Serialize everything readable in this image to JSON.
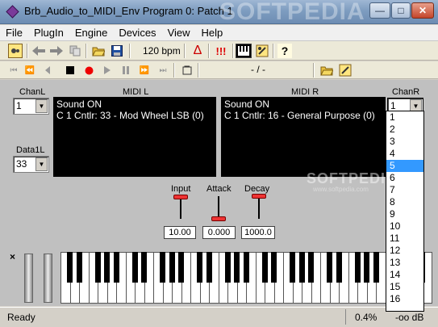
{
  "window": {
    "title": "Brb_Audio_to_MIDI_Env Program 0: Patch   1",
    "watermark": "SOFTPEDIA",
    "minimize": "—",
    "maximize": "□",
    "close": "✕"
  },
  "menu": [
    "File",
    "PlugIn",
    "Engine",
    "Devices",
    "View",
    "Help"
  ],
  "toolbar": {
    "tempo": "120 bpm",
    "position": "- / -",
    "metronome_glyph": "Δ",
    "alert_glyph": "!!!",
    "help_glyph": "?"
  },
  "left_channel": {
    "label": "ChanL",
    "value": "1",
    "data_label": "Data1L",
    "data_value": "33"
  },
  "right_channel": {
    "label": "ChanR",
    "value": "1"
  },
  "midi_l": {
    "header": "MIDI L",
    "line1": "Sound ON",
    "line2": "C 1 Cntlr: 33 - Mod Wheel LSB (0)"
  },
  "midi_r": {
    "header": "MIDI R",
    "line1": "Sound ON",
    "line2": "C 1 Cntlr: 16 - General Purpose (0)"
  },
  "watermark_main": "SOFTPEDIA",
  "watermark_url": "www.softpedia.com",
  "controls": [
    {
      "label": "Input",
      "value": "10.00",
      "level": 0.95
    },
    {
      "label": "Attack",
      "value": "0.000",
      "level": 0.0
    },
    {
      "label": "Decay",
      "value": "1000.0",
      "level": 1.0
    }
  ],
  "keyboard_close": "×",
  "status": {
    "text": "Ready",
    "cpu": "0.4%",
    "level": "-oo dB"
  },
  "chanr_options": [
    "1",
    "2",
    "3",
    "4",
    "5",
    "6",
    "7",
    "8",
    "9",
    "10",
    "11",
    "12",
    "13",
    "14",
    "15",
    "16"
  ],
  "chanr_selected_option": "5",
  "colors": {
    "selection": "#3399ff",
    "slider_knob": "#ee3333",
    "display_bg": "#000000"
  }
}
